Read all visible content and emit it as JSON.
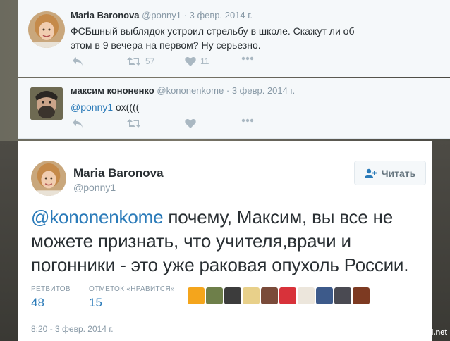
{
  "tweets": [
    {
      "author": "Maria Baronova",
      "handle": "@ponny1",
      "date": "· 3 февр. 2014 г.",
      "text": "ФСБшный выблядок устроил стрельбу в школе. Скажут ли об этом в 9 вечера на первом? Ну серьезно.",
      "retweets": "57",
      "likes": "11"
    },
    {
      "author": "максим кононенко",
      "handle": "@kononenkome",
      "date": "· 3 февр. 2014 г.",
      "mention": "@ponny1",
      "text": " ох((((",
      "retweets": "",
      "likes": ""
    }
  ],
  "main": {
    "author": "Maria Baronova",
    "handle": "@ponny1",
    "follow_label": "Читать",
    "mention": "@kononenkome",
    "text": " почему, Максим, вы все не можете признать, что учителя,врачи и погонники - это уже раковая опухоль России.",
    "retweets_label": "РЕТВИТОВ",
    "retweets": "48",
    "likes_label": "ОТМЕТОК «НРАВИТСЯ»",
    "likes": "15",
    "timestamp": "8:20 - 3 февр. 2014 г."
  },
  "watermark": "Fishki.net",
  "colors": {
    "link": "#2b7bb9",
    "text": "#292f33",
    "muted": "#8899a6"
  }
}
